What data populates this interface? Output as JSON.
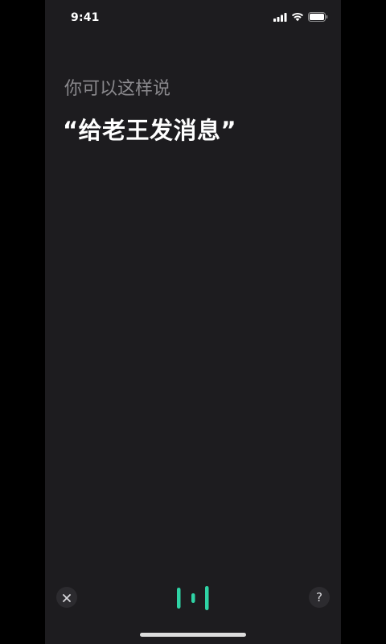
{
  "status_bar": {
    "time": "9:41",
    "icons": [
      "signal-icon",
      "wifi-icon",
      "battery-icon"
    ]
  },
  "prompt": {
    "hint": "你可以这样说",
    "suggestion": "“给老王发消息”"
  },
  "controls": {
    "close_icon": "close-icon",
    "listening_icon": "listening-waveform-icon",
    "help_label": "?"
  },
  "colors": {
    "background": "#1d1c1f",
    "accent": "#2fd3a5",
    "hint_text": "#8a898d",
    "suggestion_text": "#ffffff"
  }
}
